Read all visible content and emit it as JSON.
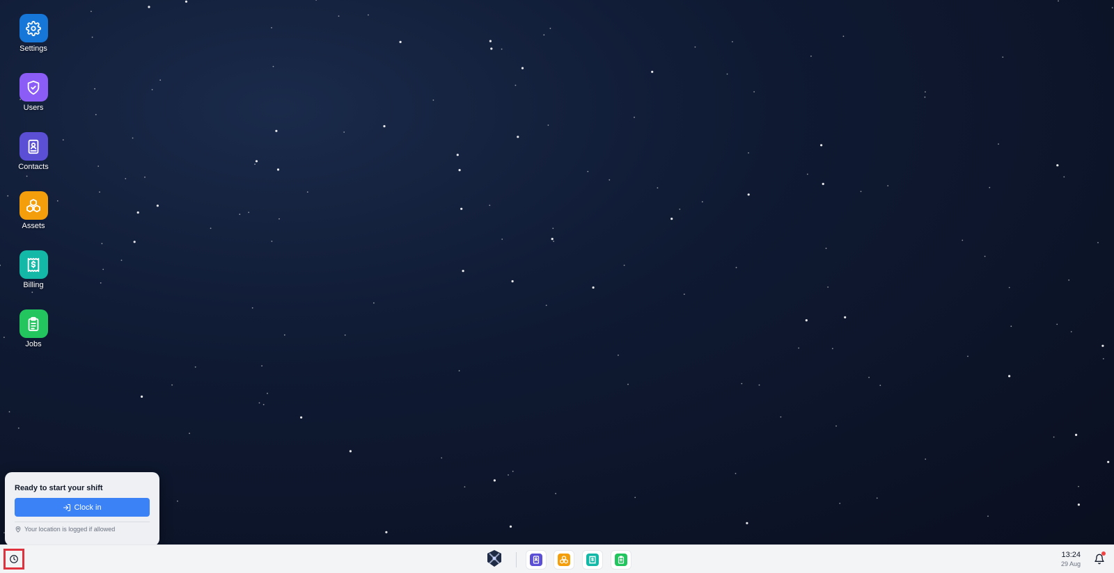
{
  "desktop": {
    "icons": [
      {
        "label": "Settings",
        "color": "#1677d9",
        "icon": "gear-icon"
      },
      {
        "label": "Users",
        "color": "#8b5cf6",
        "icon": "shield-check-icon"
      },
      {
        "label": "Contacts",
        "color": "#5b4fd6",
        "icon": "contact-book-icon"
      },
      {
        "label": "Assets",
        "color": "#f59e0b",
        "icon": "cubes-icon"
      },
      {
        "label": "Billing",
        "color": "#14b8a6",
        "icon": "receipt-dollar-icon"
      },
      {
        "label": "Jobs",
        "color": "#22c55e",
        "icon": "clipboard-icon"
      }
    ]
  },
  "shift_popup": {
    "title": "Ready to start your shift",
    "button_label": "Clock in",
    "note": "Your location is logged if allowed",
    "accent": "#3b82f6"
  },
  "taskbar": {
    "apps": [
      {
        "name": "Contacts",
        "color": "#5b4fd6",
        "icon": "contact-book-icon"
      },
      {
        "name": "Assets",
        "color": "#f59e0b",
        "icon": "cubes-icon"
      },
      {
        "name": "Billing",
        "color": "#14b8a6",
        "icon": "receipt-dollar-icon"
      },
      {
        "name": "Jobs",
        "color": "#22c55e",
        "icon": "clipboard-icon"
      }
    ],
    "time": "13:24",
    "date": "29 Aug",
    "highlight_color": "#e0313f"
  }
}
